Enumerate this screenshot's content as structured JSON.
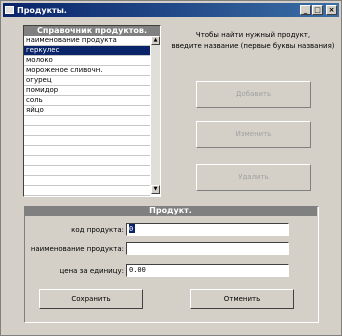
{
  "window": {
    "title": "Продукты."
  },
  "list": {
    "title": "Справочник продуктов.",
    "header": "наименование продукта",
    "items": [
      "геркулес",
      "молоко",
      "мороженое сливочн.",
      "огурец",
      "помидор",
      "соль",
      "яйцо"
    ],
    "selected_index": 0
  },
  "info": {
    "line1": "Чтобы найти нужный продукт,",
    "line2": "введите название (первые буквы названия)"
  },
  "actions": {
    "add_label": "Добавить",
    "edit_label": "Изменить",
    "delete_label": "Удалить"
  },
  "product": {
    "title": "Продукт.",
    "code_label": "код продукта:",
    "code_value": "0",
    "name_label": "наименование продукта:",
    "name_value": "",
    "price_label": "цена за единицу:",
    "price_value": "0.00",
    "save_label": "Сохранить",
    "cancel_label": "Отменить"
  }
}
